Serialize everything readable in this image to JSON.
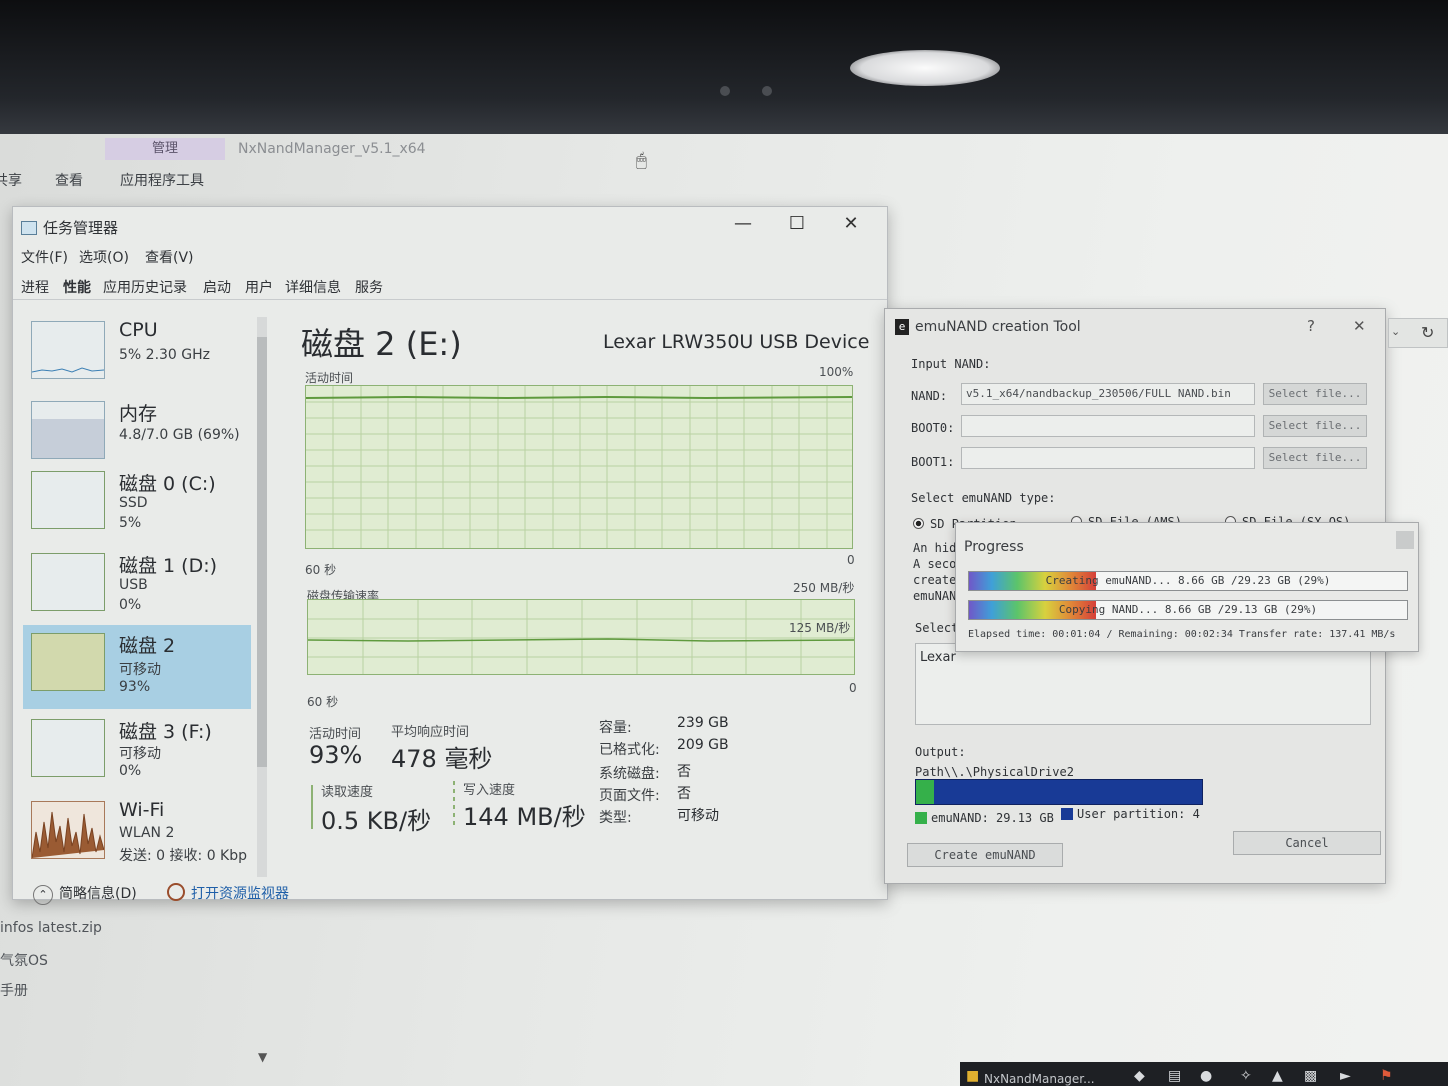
{
  "explorer": {
    "ribbon_manage": "管理",
    "app_title": "NxNandManager_v5.1_x64",
    "tab_share": "共享",
    "tab_view": "查看",
    "tab_app_tools": "应用程序工具",
    "bg_file_zip": "infos latest.zip",
    "bg_file_os": "气氛OS",
    "bg_file_guide": "手册",
    "taskbar_item": "NxNandManager..."
  },
  "task_manager": {
    "title": "任务管理器",
    "menu": [
      "文件(F)",
      "选项(O)",
      "查看(V)"
    ],
    "tabs": [
      "进程",
      "性能",
      "应用历史记录",
      "启动",
      "用户",
      "详细信息",
      "服务"
    ],
    "side": [
      {
        "name": "CPU",
        "sub1": "5% 2.30 GHz",
        "sub2": ""
      },
      {
        "name": "内存",
        "sub1": "4.8/7.0 GB (69%)",
        "sub2": ""
      },
      {
        "name": "磁盘 0 (C:)",
        "sub1": "SSD",
        "sub2": "5%"
      },
      {
        "name": "磁盘 1 (D:)",
        "sub1": "USB",
        "sub2": "0%"
      },
      {
        "name": "磁盘 2",
        "sub1": "可移动",
        "sub2": "93%"
      },
      {
        "name": "磁盘 3 (F:)",
        "sub1": "可移动",
        "sub2": "0%"
      },
      {
        "name": "Wi-Fi",
        "sub1": "WLAN 2",
        "sub2": "发送: 0 接收: 0 Kbp"
      }
    ],
    "main": {
      "title": "磁盘 2 (E:)",
      "device": "Lexar LRW350U USB Device",
      "active_time_label": "活动时间",
      "active_time_max": "100%",
      "time_span": "60 秒",
      "zero": "0",
      "transfer_label": "磁盘传输速率",
      "transfer_max": "250 MB/秒",
      "transfer_mid": "125 MB/秒",
      "active_time_stat_label": "活动时间",
      "active_time_stat": "93%",
      "avg_response_label": "平均响应时间",
      "avg_response": "478 毫秒",
      "read_label": "读取速度",
      "read": "0.5 KB/秒",
      "write_label": "写入速度",
      "write": "144 MB/秒",
      "capacity_label": "容量:",
      "capacity": "239 GB",
      "formatted_label": "已格式化:",
      "formatted": "209 GB",
      "system_disk_label": "系统磁盘:",
      "system_disk": "否",
      "page_file_label": "页面文件:",
      "page_file": "否",
      "type_label": "类型:",
      "type": "可移动"
    },
    "footer": {
      "summary": "简略信息(D)",
      "resmon": "打开资源监视器"
    }
  },
  "emunand": {
    "title": "emuNAND creation Tool",
    "help": "?",
    "input_nand_label": "Input NAND:",
    "nand_label": "NAND:",
    "nand_value": "v5.1_x64/nandbackup_230506/FULL NAND.bin",
    "boot0_label": "BOOT0:",
    "boot1_label": "BOOT1:",
    "select_file": "Select file...",
    "type_label": "Select emuNAND type:",
    "type_options": [
      "SD Partition",
      "SD File (AMS)",
      "SD File (SX OS)"
    ],
    "desc_lines": [
      "An hid",
      "A seco",
      "create",
      "emuNAN"
    ],
    "select_drive_label": "Select",
    "drive_item": "Lexar",
    "output_label": "Output:",
    "output_path": "Path\\\\.\\PhysicalDrive2",
    "legend_emunand": "emuNAND: 29.13 GB",
    "legend_user": "User partition: 4",
    "create_button": "Create emuNAND",
    "cancel_button": "Cancel"
  },
  "progress": {
    "title": "Progress",
    "bar1_text": "Creating emuNAND... 8.66 GB /29.23 GB (29%)",
    "bar1_percent": 29,
    "bar2_text": "Copying NAND... 8.66 GB /29.13 GB (29%)",
    "bar2_percent": 29,
    "elapsed": "Elapsed time: 00:01:04 / Remaining: 00:02:34 Transfer rate: 137.41 MB/s"
  },
  "colors": {
    "selected_item": "#a8cfe3",
    "disk_graph_line": "#8db274",
    "output_bar": "#183a96",
    "emunand_segment": "#35b04a"
  }
}
